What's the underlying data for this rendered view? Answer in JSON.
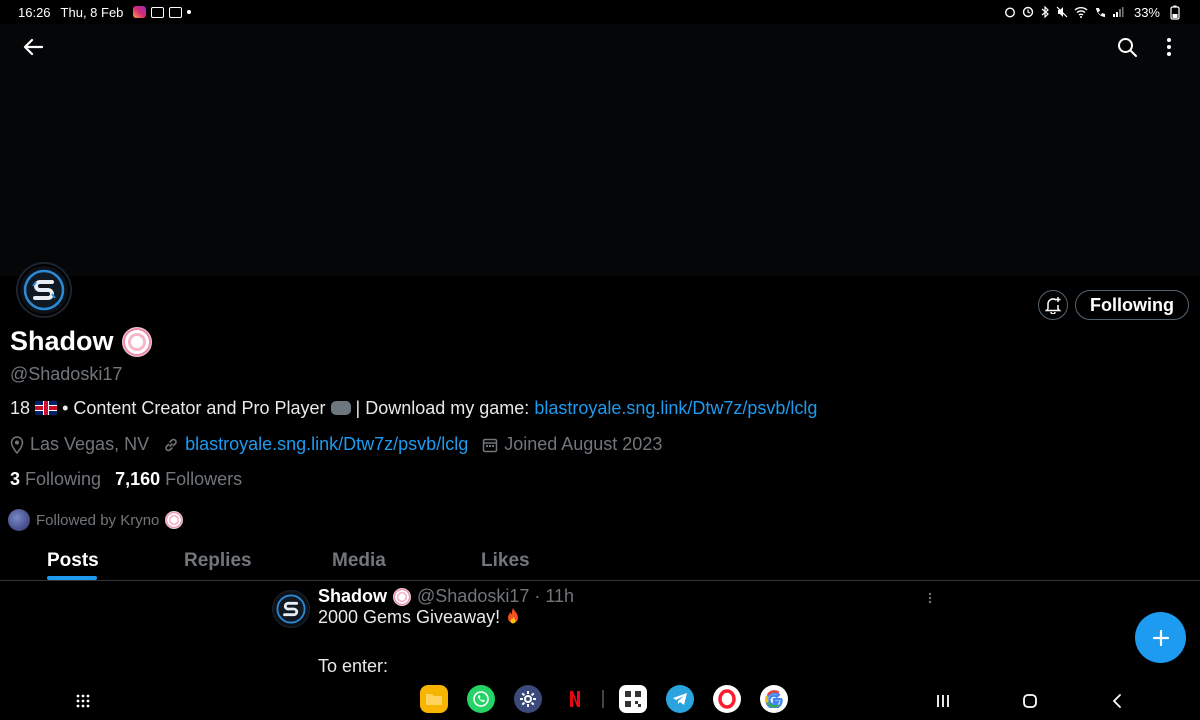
{
  "status_bar": {
    "time": "16:26",
    "date": "Thu, 8 Feb",
    "battery": "33%"
  },
  "profile": {
    "name": "Shadow",
    "handle": "@Shadoski17",
    "bio_prefix": "18",
    "bio_middle": "• Content Creator and Pro Player",
    "bio_suffix": "| Download my game:",
    "bio_link": "blastroyale.sng.link/Dtw7z/psvb/lclg",
    "location": "Las Vegas, NV",
    "website": "blastroyale.sng.link/Dtw7z/psvb/lclg",
    "joined": "Joined August 2023",
    "following_count": "3",
    "following_label": "Following",
    "followers_count": "7,160",
    "followers_label": "Followers",
    "followed_by": "Followed by Kryno",
    "follow_button_label": "Following"
  },
  "tabs": [
    {
      "label": "Posts",
      "active": true
    },
    {
      "label": "Replies",
      "active": false
    },
    {
      "label": "Media",
      "active": false
    },
    {
      "label": "Likes",
      "active": false
    }
  ],
  "post": {
    "author": "Shadow",
    "handle_time": "@Shadoski17 · 11h",
    "line1": "2000 Gems Giveaway!",
    "line2": "To enter:"
  },
  "colors": {
    "accent": "#1d9bf0",
    "muted": "#71767b",
    "background": "#000000"
  },
  "dock_apps": [
    "files-icon",
    "whatsapp-icon",
    "settings-icon",
    "netflix-icon",
    "qr-scanner-icon",
    "telegram-icon",
    "opera-icon",
    "google-icon"
  ]
}
